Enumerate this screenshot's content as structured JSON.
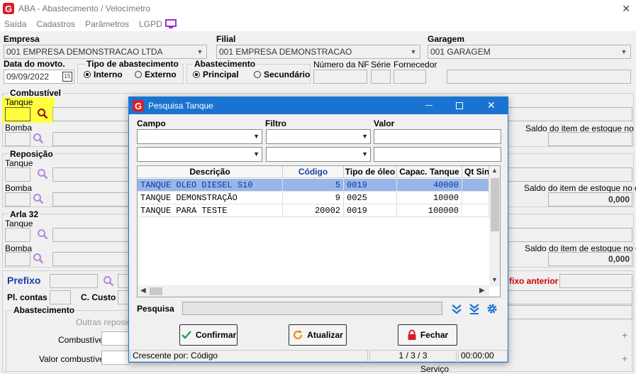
{
  "window": {
    "title": "ABA - Abastecimento / Velocímetro",
    "close": "✕"
  },
  "menu": [
    "Saída",
    "Cadastros",
    "Parâmetros",
    "LGPD"
  ],
  "colors": {
    "accent": "#1a73d0",
    "brand": "#d61f26",
    "selection": "#99b6e8",
    "highlight": "#ffff3b"
  },
  "labels": {
    "empresa": "Empresa",
    "filial": "Filial",
    "garagem": "Garagem",
    "data_movto": "Data do movto.",
    "tipo_abastecimento": "Tipo de abastecimento",
    "interno": "Interno",
    "externo": "Externo",
    "abastecimento": "Abastecimento",
    "principal": "Principal",
    "secundario": "Secundário",
    "numero_nf": "Número da NF",
    "serie": "Série",
    "fornecedor": "Fornecedor",
    "combustivel": "Combustível",
    "tanque": "Tanque",
    "bomba": "Bomba",
    "saldo": "Saldo do item de estoque no dia",
    "reposicao": "Reposição",
    "arla": "Arla 32",
    "prefixo": "Prefixo",
    "prefixo_anterior": "fixo anterior",
    "pl_contas": "Pl. contas",
    "c_custo": "C. Custo",
    "abastecimento2": "Abastecimento",
    "outras_reposicoes": "Outras reposiçõ",
    "combustivel2": "Combustível",
    "valor_combustivel": "Valor combustível",
    "servico": "Serviço"
  },
  "values": {
    "empresa": "001 EMPRESA DEMONSTRACAO LTDA",
    "filial": "001 EMPRESA DEMONSTRACAO",
    "garagem": "001 GARAGEM",
    "data": "09/09/2022",
    "calendar": "15",
    "saldo_reposicao": "0,000",
    "saldo_arla": "0,000"
  },
  "dialog": {
    "title": "Pesquisa Tanque",
    "campo": "Campo",
    "filtro": "Filtro",
    "valor": "Valor",
    "columns": [
      "Descrição",
      "Código",
      "Tipo de óleo",
      "Capac. Tanque",
      "Qt Sin"
    ],
    "rows": [
      [
        "TANQUE OLEO DIESEL S10",
        "5",
        "0019",
        "40000"
      ],
      [
        "TANQUE DEMONSTRAÇÃO",
        "9",
        "0025",
        "10000"
      ],
      [
        "TANQUE PARA TESTE",
        "20002",
        "0019",
        "100000"
      ]
    ],
    "pesquisa": "Pesquisa",
    "confirmar": "Confirmar",
    "atualizar": "Atualizar",
    "fechar": "Fechar",
    "status_sort": "Crescente por: Código",
    "status_count": "1 / 3 / 3",
    "status_time": "00:00:00"
  }
}
